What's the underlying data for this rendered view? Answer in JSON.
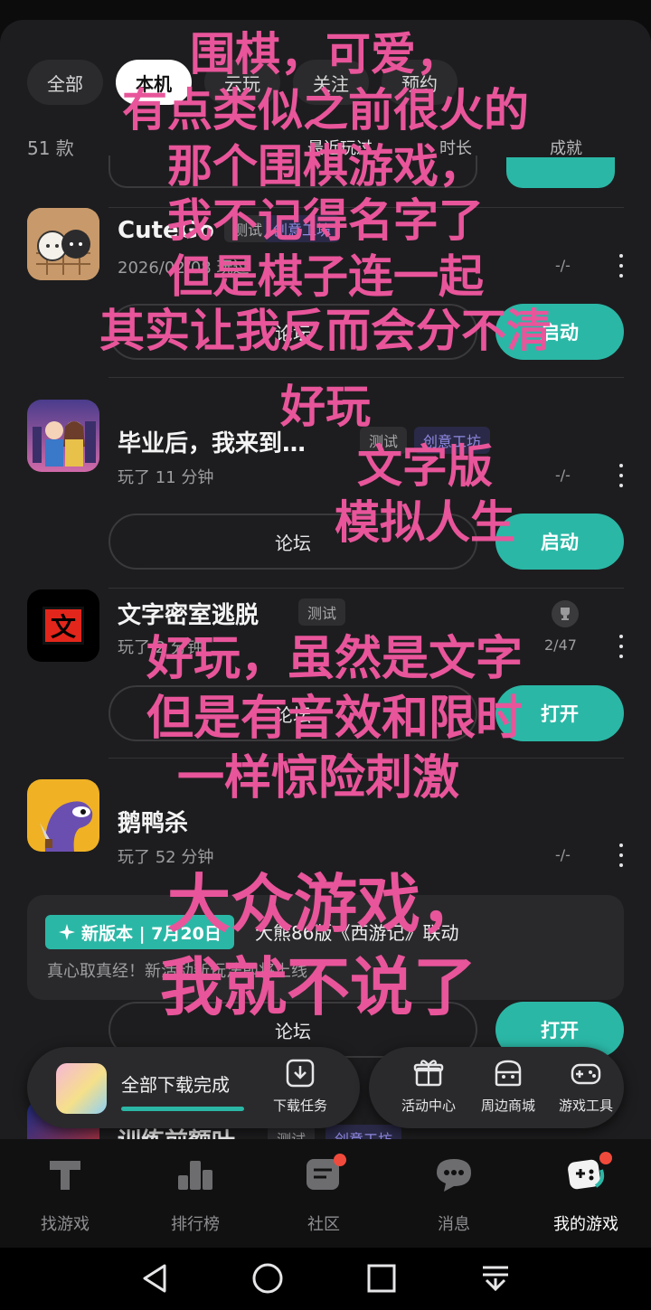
{
  "filter_tabs": [
    "全部",
    "本机",
    "云玩",
    "关注",
    "预约"
  ],
  "count": "51 款",
  "sort": {
    "recent": "最近玩过",
    "duration": "时长",
    "achievement": "成就"
  },
  "games": [
    {
      "name": "CuteGo",
      "tags": {
        "test": "测试",
        "craft": "创意工坊"
      },
      "meta": "2026/02/08 玩过",
      "achievement": "-/-",
      "forum": "论坛",
      "action": "启动"
    },
    {
      "name": "毕业后，我来到…",
      "tags": {
        "test": "测试",
        "craft": "创意工坊"
      },
      "meta": "玩了 11 分钟",
      "achievement": "-/-",
      "forum": "论坛",
      "action": "启动"
    },
    {
      "name": "文字密室逃脱",
      "tags": {
        "test": "测试"
      },
      "meta": "玩了 2 分钟",
      "achievement": "2/47",
      "forum": "论坛",
      "action": "打开"
    },
    {
      "name": "鹅鸭杀",
      "tags": {},
      "meta": "玩了 52 分钟",
      "achievement": "-/-",
      "forum": "论坛",
      "action": "打开"
    },
    {
      "name": "训练前额叶",
      "tags": {
        "test": "测试",
        "craft": "创意工坊"
      }
    }
  ],
  "icon_char": "文",
  "news": {
    "badge": "新版本 | 7月20日",
    "title": "大熊86版《西游记》联动",
    "subtitle": "真心取真经！新活动新玩法即将上线"
  },
  "dock": {
    "status": "全部下载完成",
    "tasks": "下载任务",
    "items": [
      "活动中心",
      "周边商城",
      "游戏工具"
    ]
  },
  "nav": [
    "找游戏",
    "排行榜",
    "社区",
    "消息",
    "我的游戏"
  ],
  "overlay": {
    "block1": [
      "围棋，可爱，",
      "有点类似之前很火的",
      "那个围棋游戏，",
      "我不记得名字了",
      "但是棋子连一起",
      "其实让我反而会分不清",
      "好玩"
    ],
    "block2": [
      "文字版",
      "模拟人生"
    ],
    "block3": [
      "好玩，虽然是文字",
      "但是有音效和限时",
      "一样惊险刺激"
    ],
    "block4": [
      "大众游戏，",
      "我就不说了"
    ]
  },
  "colors": {
    "accent": "#2bb7a6",
    "overlay_text": "#e8559a",
    "badge_red": "#f04a3c"
  }
}
